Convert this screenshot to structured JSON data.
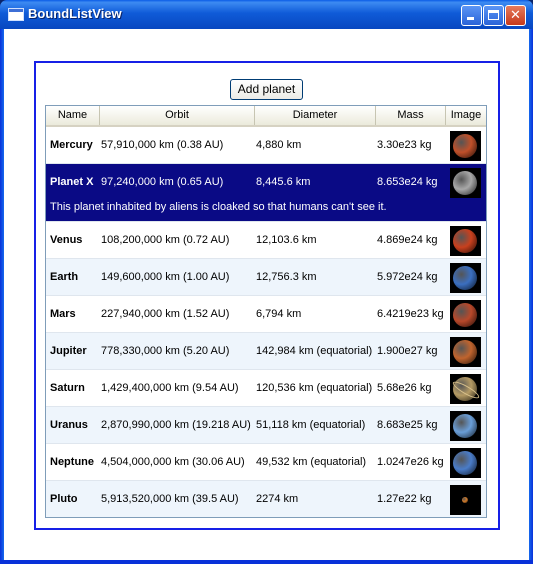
{
  "window": {
    "title": "BoundListView"
  },
  "toolbar": {
    "add_label": "Add planet"
  },
  "columns": [
    "Name",
    "Orbit",
    "Diameter",
    "Mass",
    "Image"
  ],
  "planets": [
    {
      "name": "Mercury",
      "orbit": "57,910,000 km (0.38 AU)",
      "diameter": "4,880 km",
      "mass": "3.30e23 kg",
      "image": "mercury-icon",
      "color": "#c0502a"
    },
    {
      "name": "Planet X",
      "orbit": "97,240,000 km (0.65 AU)",
      "diameter": "8,445.6 km",
      "mass": "8.653e24 kg",
      "image": "planet-x-icon",
      "color": "#a8a8a8",
      "selected": true,
      "description": "This planet inhabited by aliens is cloaked so that humans can't see it."
    },
    {
      "name": "Venus",
      "orbit": "108,200,000 km (0.72 AU)",
      "diameter": "12,103.6 km",
      "mass": "4.869e24 kg",
      "image": "venus-icon",
      "color": "#c8401e"
    },
    {
      "name": "Earth",
      "orbit": "149,600,000 km (1.00 AU)",
      "diameter": "12,756.3 km",
      "mass": "5.972e24 kg",
      "image": "earth-icon",
      "color": "#3b6fc0"
    },
    {
      "name": "Mars",
      "orbit": "227,940,000 km (1.52 AU)",
      "diameter": "6,794 km",
      "mass": "6.4219e23 kg",
      "image": "mars-icon",
      "color": "#b8482a"
    },
    {
      "name": "Jupiter",
      "orbit": "778,330,000 km (5.20 AU)",
      "diameter": "142,984 km (equatorial)",
      "mass": "1.900e27 kg",
      "image": "jupiter-icon",
      "color": "#c0642e"
    },
    {
      "name": "Saturn",
      "orbit": "1,429,400,000 km (9.54 AU)",
      "diameter": "120,536 km (equatorial)",
      "mass": "5.68e26 kg",
      "image": "saturn-icon",
      "color": "#b49a64"
    },
    {
      "name": "Uranus",
      "orbit": "2,870,990,000 km (19.218 AU)",
      "diameter": "51,118 km (equatorial)",
      "mass": "8.683e25 kg",
      "image": "uranus-icon",
      "color": "#6a9ed8"
    },
    {
      "name": "Neptune",
      "orbit": "4,504,000,000 km (30.06 AU)",
      "diameter": "49,532 km (equatorial)",
      "mass": "1.0247e26 kg",
      "image": "neptune-icon",
      "color": "#4a7cc8"
    },
    {
      "name": "Pluto",
      "orbit": "5,913,520,000 km (39.5 AU)",
      "diameter": "2274 km",
      "mass": "1.27e22 kg",
      "image": "pluto-icon",
      "color": "#d07a2a"
    }
  ]
}
